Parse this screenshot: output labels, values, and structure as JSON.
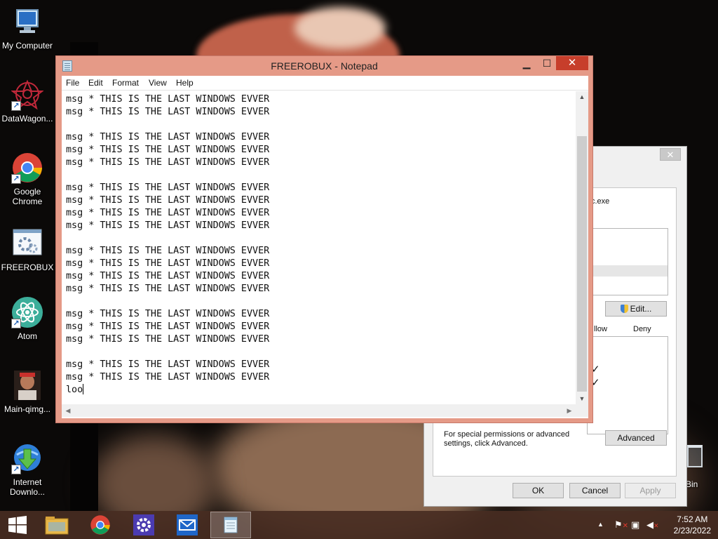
{
  "desktop": {
    "icons": [
      {
        "label": "My Computer",
        "icon": "computer-icon"
      },
      {
        "label": "DataWagon...",
        "icon": "datawagon-icon"
      },
      {
        "label": "Google Chrome",
        "icon": "chrome-icon"
      },
      {
        "label": "FREEROBUX",
        "icon": "batch-file-icon"
      },
      {
        "label": "Atom",
        "icon": "atom-icon"
      },
      {
        "label": "Main-qimg...",
        "icon": "image-file-icon"
      },
      {
        "label": "Internet Downlo...",
        "icon": "idm-icon"
      }
    ],
    "recycle_bin_partial": "e Bin"
  },
  "notepad": {
    "title": "FREEROBUX - Notepad",
    "menu": [
      "File",
      "Edit",
      "Format",
      "View",
      "Help"
    ],
    "lines": [
      "msg * THIS IS THE LAST WINDOWS EVVER",
      "msg * THIS IS THE LAST WINDOWS EVVER",
      "",
      "msg * THIS IS THE LAST WINDOWS EVVER",
      "msg * THIS IS THE LAST WINDOWS EVVER",
      "msg * THIS IS THE LAST WINDOWS EVVER",
      "",
      "msg * THIS IS THE LAST WINDOWS EVVER",
      "msg * THIS IS THE LAST WINDOWS EVVER",
      "msg * THIS IS THE LAST WINDOWS EVVER",
      "msg * THIS IS THE LAST WINDOWS EVVER",
      "",
      "msg * THIS IS THE LAST WINDOWS EVVER",
      "msg * THIS IS THE LAST WINDOWS EVVER",
      "msg * THIS IS THE LAST WINDOWS EVVER",
      "msg * THIS IS THE LAST WINDOWS EVVER",
      "",
      "msg * THIS IS THE LAST WINDOWS EVVER",
      "msg * THIS IS THE LAST WINDOWS EVVER",
      "msg * THIS IS THE LAST WINDOWS EVVER",
      "",
      "msg * THIS IS THE LAST WINDOWS EVVER",
      "msg * THIS IS THE LAST WINDOWS EVVER",
      "loo"
    ],
    "close_glyph": "✕",
    "min_glyph": "▁",
    "max_glyph": "☐"
  },
  "permissions_dialog": {
    "file_partial": "c.exe",
    "edit_button": "Edit...",
    "col_allow": "llow",
    "col_deny": "Deny",
    "check_glyph": "✓",
    "special_text": "For special permissions or advanced settings, click Advanced.",
    "advanced_button": "Advanced",
    "ok_button": "OK",
    "cancel_button": "Cancel",
    "apply_button": "Apply",
    "close_glyph": "✕"
  },
  "taskbar": {
    "pinned": [
      "start-button",
      "file-explorer",
      "google-chrome",
      "control-panel",
      "mail",
      "notepad"
    ],
    "active": "notepad",
    "clock_time": "7:52 AM",
    "clock_date": "2/23/2022"
  },
  "colors": {
    "notepad_frame": "#e59a87",
    "close_red": "#c73e2b",
    "taskbar": "#482c22"
  }
}
